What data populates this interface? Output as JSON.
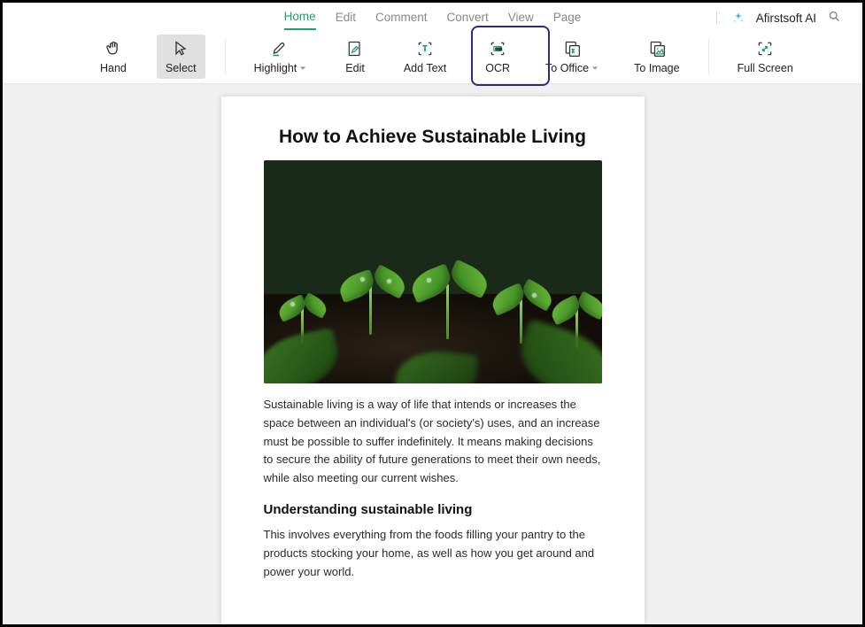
{
  "menu": {
    "items": [
      "Home",
      "Edit",
      "Comment",
      "Convert",
      "View",
      "Page"
    ],
    "active_index": 0,
    "ai_label": "Afirstsoft AI"
  },
  "toolbar": {
    "hand": "Hand",
    "select": "Select",
    "highlight": "Highlight",
    "edit": "Edit",
    "add_text": "Add Text",
    "ocr": "OCR",
    "to_office": "To Office",
    "to_image": "To Image",
    "full_screen": "Full Screen"
  },
  "document": {
    "title": "How to Achieve Sustainable Living",
    "para1": "Sustainable living is a way of life that intends or increases the space between an individual's (or society's) uses, and an increase must be possible to suffer indefinitely. It means making decisions to secure the ability of future generations to meet their own needs, while also meeting our current wishes.",
    "h2": "Understanding sustainable living",
    "para2": "This involves everything from the foods filling your pantry to the products stocking your home, as well as how you get around and power your world."
  },
  "colors": {
    "accent": "#1aa36b",
    "annotation": "#2a2b85"
  }
}
